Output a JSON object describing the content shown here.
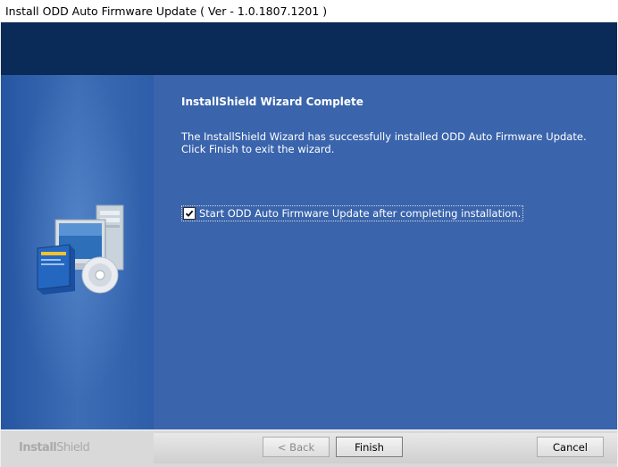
{
  "window": {
    "title": "Install ODD Auto Firmware Update ( Ver - 1.0.1807.1201 )"
  },
  "content": {
    "heading": "InstallShield Wizard Complete",
    "description": "The InstallShield Wizard has successfully installed ODD Auto Firmware Update.  Click Finish to exit the wizard.",
    "launch_checkbox": {
      "label": "Start ODD Auto Firmware Update after completing installation.",
      "checked": true
    }
  },
  "footer": {
    "brand_bold": "Install",
    "brand_light": "Shield",
    "back_label": "< Back",
    "finish_label": "Finish",
    "cancel_label": "Cancel"
  },
  "colors": {
    "top_band": "#0a2a57",
    "panel_blue": "#3a64ac"
  },
  "icons": [
    "computer-cd-install-icon",
    "checkmark-icon"
  ]
}
